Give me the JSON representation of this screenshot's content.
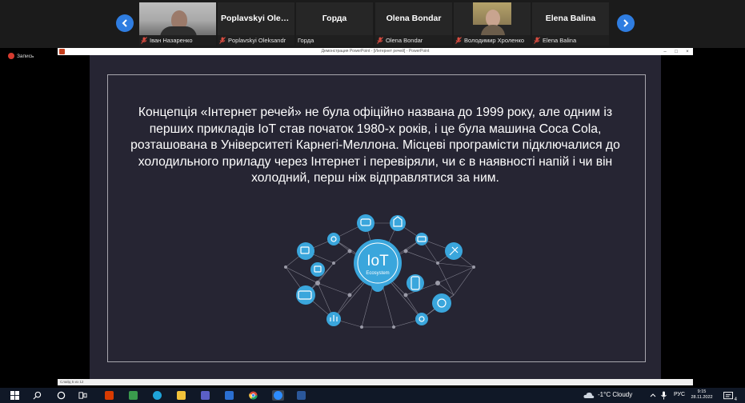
{
  "participants": [
    {
      "display_name": "",
      "label": "Іван Назаренко",
      "video": true
    },
    {
      "display_name": "Poplavskyi Olek...",
      "label": "Poplavskyi Oleksandr",
      "video": false
    },
    {
      "display_name": "Горда",
      "label": "Горда",
      "video": false
    },
    {
      "display_name": "Olena Bondar",
      "label": "Olena Bondar",
      "video": false
    },
    {
      "display_name": "",
      "label": "Володимир Хроленко",
      "video": true
    },
    {
      "display_name": "Elena Balina",
      "label": "Elena Balina",
      "video": false
    }
  ],
  "recording": {
    "label": "Запись"
  },
  "powerpoint": {
    "window_title": "Демонстрация PowerPoint - [Интернет речей] - PowerPoint",
    "status_text": "Слайд 5 из 12",
    "window_controls": [
      "–",
      "□",
      "×"
    ]
  },
  "slide": {
    "text": "Концепція «Інтернет речей» не була офіційно названа до 1999 року, але одним із перших прикладів IoT став початок 1980-х років, і це була машина Coca Cola, розташована в Університеті Карнегі-Меллона. Місцеві програмісти підключалися до холодильного приладу через Інтернет і перевіряли, чи є в наявності напій і чи він холодний, перш ніж відправлятися за ним.",
    "graphic": {
      "title": "IoT",
      "subtitle": "Ecosystem",
      "accent_color": "#3aa6dc"
    }
  },
  "taskbar": {
    "weather": "-1°C  Cloudy",
    "language": "РУС",
    "time": "9:15",
    "date": "28.11.2022",
    "notification_count": "4"
  },
  "colors": {
    "slide_background": "#262533",
    "nav_button": "#2f7de1",
    "record": "#d63b2f"
  }
}
